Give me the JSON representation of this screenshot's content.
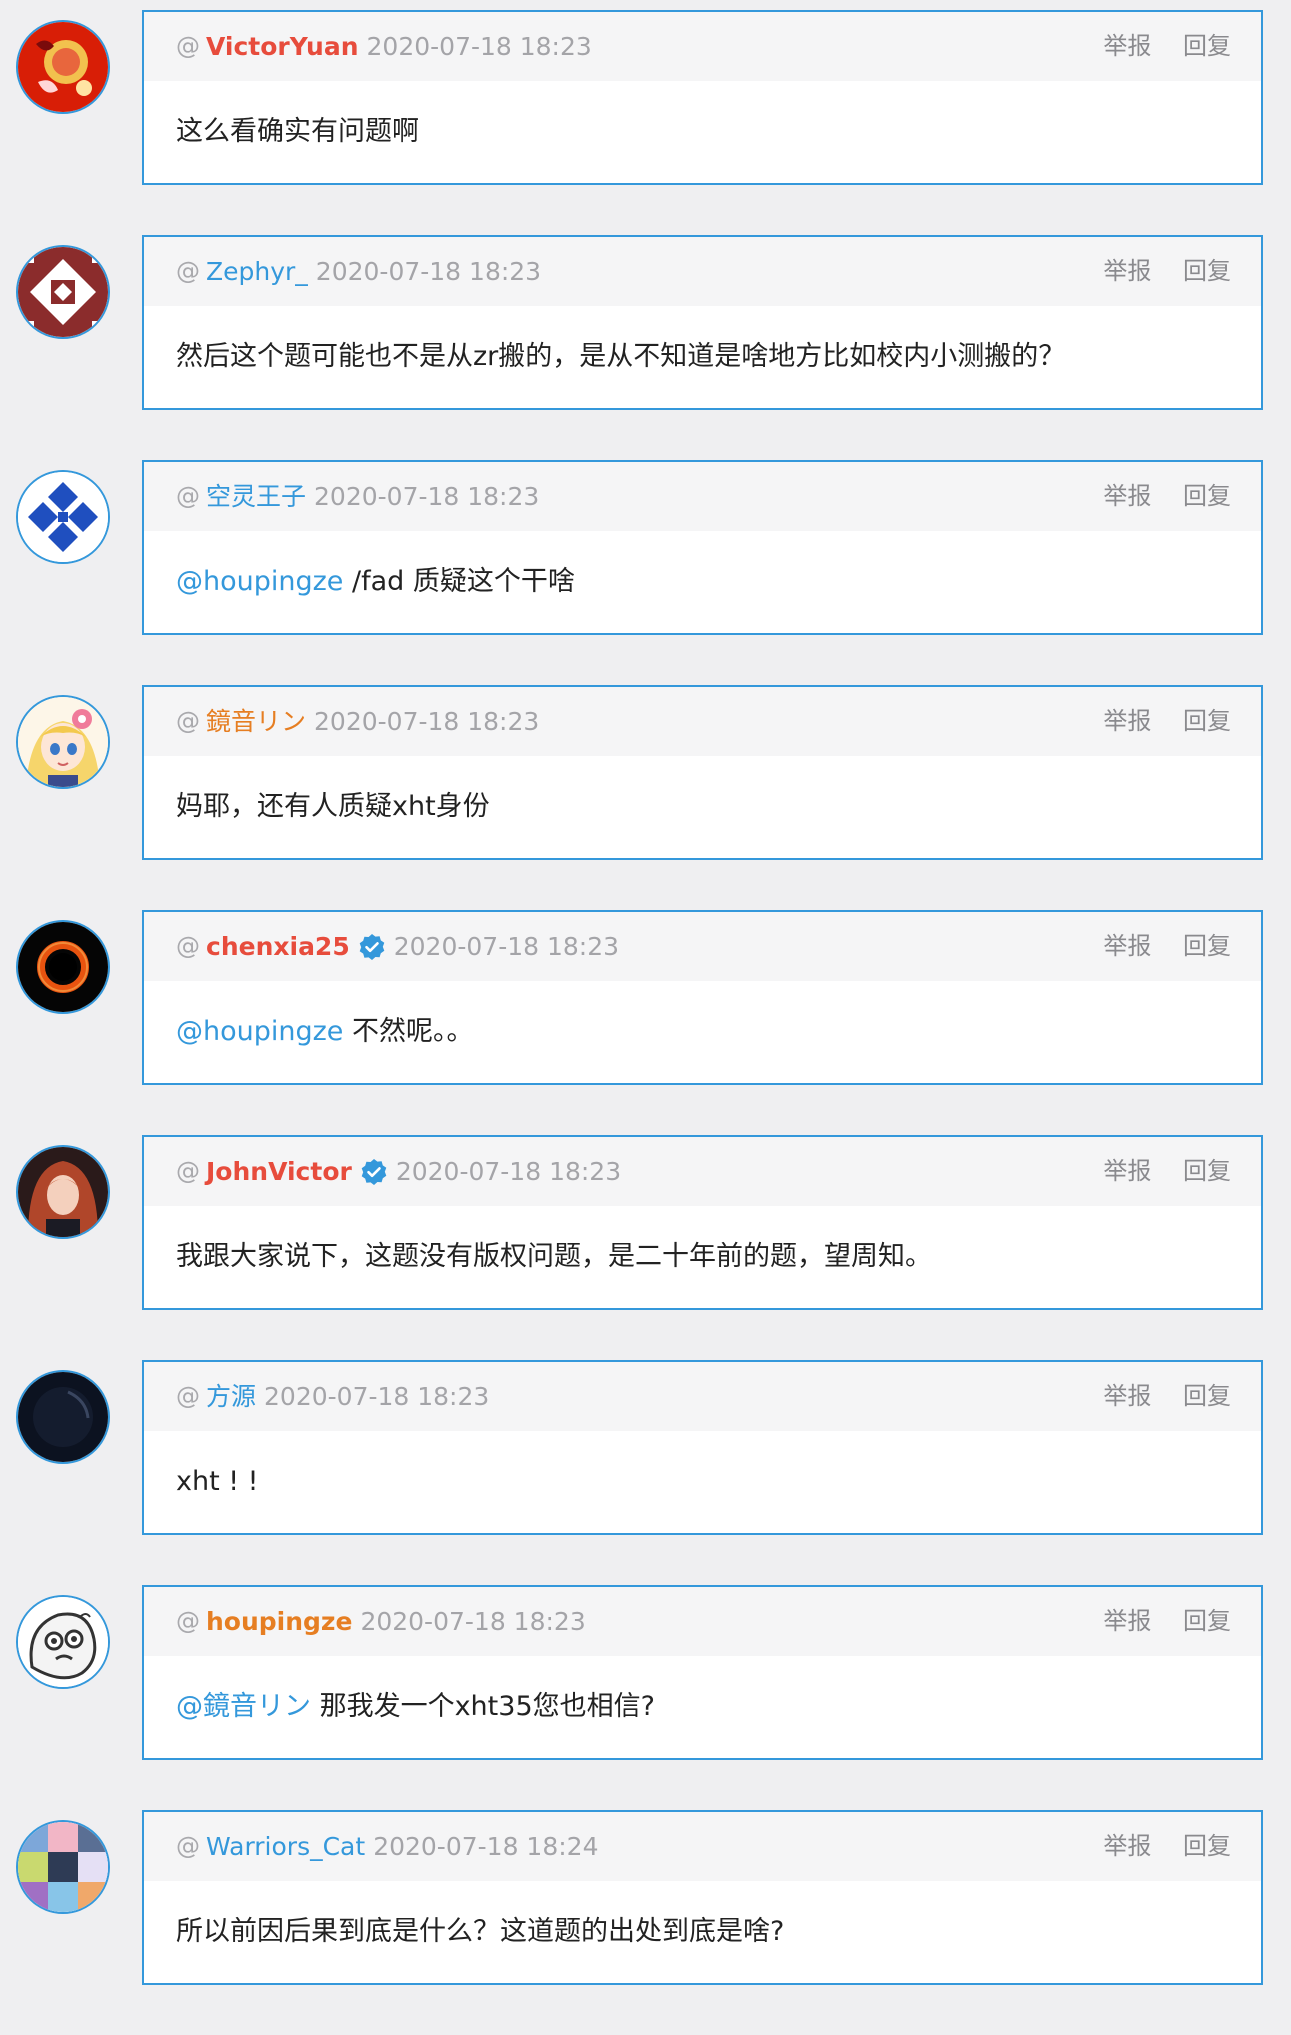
{
  "actions": {
    "report_label": "举报",
    "reply_label": "回复"
  },
  "colors": {
    "accent_border": "#3498db",
    "mention": "#3498db",
    "name_red": "#e74c3c",
    "name_orange": "#e67e22",
    "page_background": "#efeff1",
    "card_header_background": "#f5f5f6"
  },
  "comments": [
    {
      "username": "VictorYuan",
      "name_color": "red",
      "verified": false,
      "timestamp": "2020-07-18 18:23",
      "avatar_icon": "red-flower-avatar-icon",
      "mention": "",
      "text": "这么看确实有问题啊"
    },
    {
      "username": "Zephyr_",
      "name_color": "blue",
      "verified": false,
      "timestamp": "2020-07-18 18:23",
      "avatar_icon": "brown-identicon-avatar-icon",
      "mention": "",
      "text": "然后这个题可能也不是从zr搬的，是从不知道是啥地方比如校内小测搬的？"
    },
    {
      "username": "空灵王子",
      "name_color": "blue",
      "verified": false,
      "timestamp": "2020-07-18 18:23",
      "avatar_icon": "blue-identicon-avatar-icon",
      "mention": "@houpingze",
      "text": " /fad 质疑这个干啥"
    },
    {
      "username": "鏡音リン",
      "name_color": "orange",
      "verified": false,
      "timestamp": "2020-07-18 18:23",
      "avatar_icon": "anime-girl-avatar-icon",
      "mention": "",
      "text": "妈耶，还有人质疑xht身份"
    },
    {
      "username": "chenxia25",
      "name_color": "red",
      "verified": true,
      "timestamp": "2020-07-18 18:23",
      "avatar_icon": "black-hole-avatar-icon",
      "mention": "@houpingze",
      "text": " 不然呢。。"
    },
    {
      "username": "JohnVictor",
      "name_color": "red",
      "verified": true,
      "timestamp": "2020-07-18 18:23",
      "avatar_icon": "red-hair-anime-avatar-icon",
      "mention": "",
      "text": "我跟大家说下，这题没有版权问题，是二十年前的题，望周知。"
    },
    {
      "username": "方源",
      "name_color": "blue",
      "verified": false,
      "timestamp": "2020-07-18 18:23",
      "avatar_icon": "dark-avatar-icon",
      "mention": "",
      "text": "xht ! !"
    },
    {
      "username": "houpingze",
      "name_color": "orange-bold",
      "verified": false,
      "timestamp": "2020-07-18 18:23",
      "avatar_icon": "meme-face-avatar-icon",
      "mention": "@鏡音リン",
      "text": " 那我发一个xht35您也相信?"
    },
    {
      "username": "Warriors_Cat",
      "name_color": "blue",
      "verified": false,
      "timestamp": "2020-07-18 18:24",
      "avatar_icon": "collage-avatar-icon",
      "mention": "",
      "text": "所以前因后果到底是什么？这道题的出处到底是啥?"
    }
  ]
}
